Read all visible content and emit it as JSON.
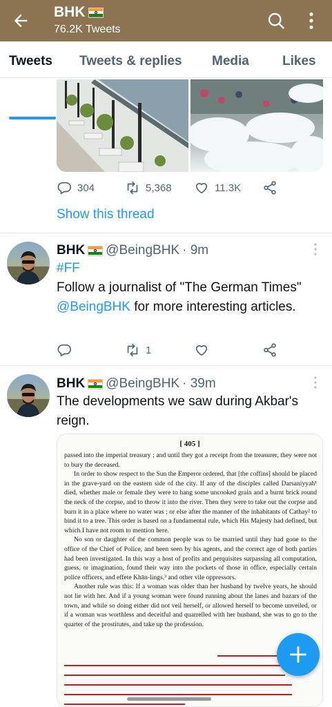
{
  "header": {
    "title": "BHK",
    "tweet_count": "76.2K Tweets"
  },
  "tabs": [
    "Tweets",
    "Tweets & replies",
    "Media",
    "Likes"
  ],
  "thread_top": {
    "actions": {
      "replies": "304",
      "retweets": "5,368",
      "likes": "11.3K"
    },
    "show_thread": "Show this thread"
  },
  "tweet1": {
    "name": "BHK",
    "handle": "@BeingBHK",
    "time": "· 9m",
    "hashtag": "#FF",
    "text_before": "Follow a journalist of \"The German Times\" ",
    "mention": "@BeingBHK",
    "text_after": " for more interesting articles.",
    "retweets": "1"
  },
  "tweet2": {
    "name": "BHK",
    "handle": "@BeingBHK",
    "time": "· 39m",
    "text": "The developments we saw during Akbar's reign."
  },
  "document": {
    "page_number": "[ 405 ]",
    "paragraphs": [
      "passed into the imperial treasury ; and until they got a receipt from the treasurer, they were not to bury the deceased.",
      "In order to show respect to the Sun the Emperor ordered, that [the coffins] should be placed in the grave-yard on the eastern side of the city. If any of the disciples called Darsaniyyah¹ died, whether male or female they were to hang some uncooked grain and a burnt brick round the neck of the corpse, and to throw it into the river. Then they were to take out the corpse and burn it in a place where no water was ; or else after the manner of the inhabitants of Cathay² to bind it to a tree. This order is based on a fundamental rule, which His Majesty had defined, but which I have not room to mention here.",
      "No son or daughter of the common people was to be married until they had gone to the office of the Chief of Police, and been seen by his agents, and the correct age of both parties had been investigated. In this way a host of profits and perquisites surpassing all computation, guess, or imagination, found their way into the pockets of those in office, especially certain police officers, and effete Khān-lings,³ and other vile oppressors.",
      "Another rule was this: If a woman was older than her husband by twelve years, he should not lie with her. And if a young woman were found running about the lanes and bazars of the town, and while so doing either did not veil herself, or allowed herself to become unveiled, or if a woman was worthless and deceitful and quarrelled with her husband, she was to go to the quarter of the prostitutes, and take up the profession."
    ]
  },
  "colors": {
    "header_bg": "#8c7453",
    "accent": "#1d9bf0",
    "underline": "#d4161c"
  },
  "icons": [
    "back-arrow-icon",
    "search-icon",
    "more-vertical-icon",
    "reply-icon",
    "retweet-icon",
    "like-icon",
    "share-icon",
    "compose-plus-icon",
    "india-flag-icon"
  ]
}
